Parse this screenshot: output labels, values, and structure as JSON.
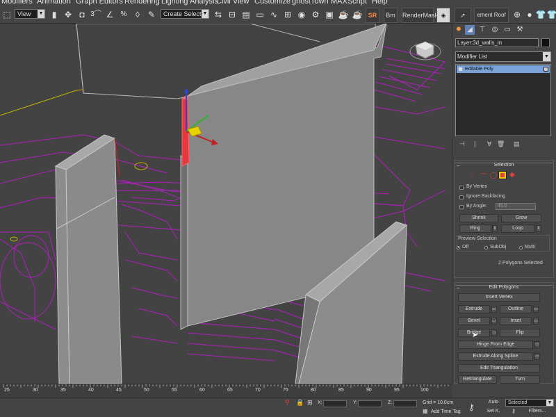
{
  "menu": [
    "Modifiers",
    "Animation",
    "Graph Editors",
    "Rendering",
    "Lighting Analysis",
    "Civil View",
    "Customize",
    "ghostTown",
    "MAXScript",
    "Help"
  ],
  "toolbar": {
    "view_combo": "View",
    "selection_set_combo": "Create Selection Se",
    "snap_label": "3",
    "percent_label": "%",
    "sr_button": "SR",
    "bm_button": "Bm",
    "render_mask": "RenderMask",
    "named_set": "ement Roof Sc"
  },
  "panel": {
    "layer": "Layer:3d_walls_in",
    "modifier_list": "Modifier List",
    "stack_item": "Editable Poly",
    "selection_title": "Selection",
    "by_vertex": "By Vertex",
    "ignore_backfacing": "Ignore Backfacing",
    "by_angle": "By Angle:",
    "angle_value": "45.0",
    "shrink": "Shrink",
    "grow": "Grow",
    "ring": "Ring",
    "loop": "Loop",
    "preview_selection": "Preview Selection",
    "preview_off": "Off",
    "preview_subobj": "SubObj",
    "preview_multi": "Multi",
    "selected_count": "2 Polygons Selected",
    "edit_polygons_title": "Edit Polygons",
    "insert_vertex": "Insert Vertex",
    "extrude": "Extrude",
    "outline": "Outline",
    "bevel": "Bevel",
    "inset": "Inset",
    "bridge": "Bridge",
    "flip": "Flip",
    "hinge_from_edge": "Hinge From Edge",
    "extrude_along_spline": "Extrude Along Spline",
    "edit_triangulation": "Edit Triangulation",
    "retriangulate": "Retriangulate",
    "turn": "Turn"
  },
  "timeline": {
    "ticks": [
      "25",
      "30",
      "35",
      "40",
      "45",
      "50",
      "55",
      "60",
      "65",
      "70",
      "75",
      "80",
      "85",
      "90",
      "95",
      "100"
    ]
  },
  "status": {
    "x_label": "X:",
    "y_label": "Y:",
    "z_label": "Z:",
    "grid": "Grid = 10.0cm",
    "add_time_tag": "Add Time Tag",
    "auto": "Auto",
    "selected": "Selected",
    "set_key": "Set K.",
    "filters": "Filters..."
  },
  "colors": {
    "selection_red": "#e5393f",
    "spline_magenta": "#b01fc0",
    "wall_gray": "#878787",
    "accent_blue": "#7aa3d8"
  }
}
